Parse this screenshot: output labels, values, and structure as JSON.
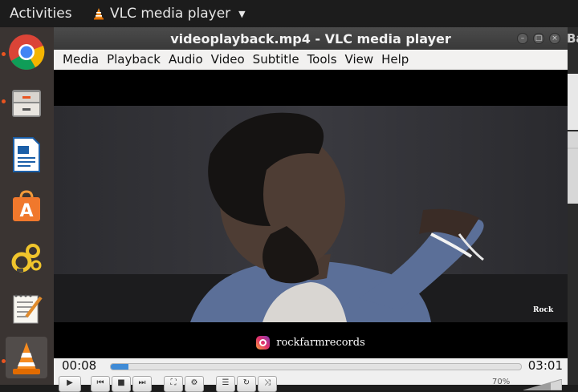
{
  "topbar": {
    "activities": "Activities",
    "app_name": "VLC media player"
  },
  "dock": {
    "items": [
      "chrome-icon",
      "files-icon",
      "writer-icon",
      "software-center-icon",
      "settings-gears-icon",
      "text-editor-icon",
      "vlc-icon"
    ]
  },
  "background": {
    "peek_text": "Ba"
  },
  "window": {
    "title": "videoplayback.mp4 - VLC media player",
    "menu": [
      "Media",
      "Playback",
      "Audio",
      "Video",
      "Subtitle",
      "Tools",
      "View",
      "Help"
    ]
  },
  "video": {
    "overlay_text": "rockfarmrecords",
    "watermark": "Rock"
  },
  "player": {
    "elapsed": "00:08",
    "total": "03:01",
    "progress_fraction": 0.044,
    "volume": "70%"
  },
  "colors": {
    "accent": "#3f8bd6",
    "running_dot": "#e95420"
  }
}
